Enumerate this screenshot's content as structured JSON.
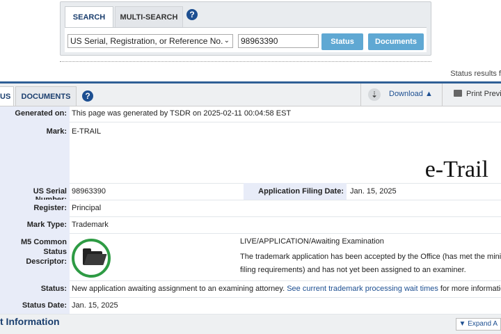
{
  "search": {
    "tabs": [
      "SEARCH",
      "MULTI-SEARCH"
    ],
    "type_selected": "US Serial, Registration, or Reference No.",
    "serial_value": "98963390",
    "status_button": "Status",
    "documents_button": "Documents"
  },
  "status_results_text": "Status results f",
  "tabs": {
    "status": "US",
    "documents": "DOCUMENTS",
    "download": "Download",
    "print": "Print Previe"
  },
  "info": {
    "generated_label": "Generated on:",
    "generated_value": "This page was generated by TSDR on 2025-02-11 00:04:58 EST",
    "mark_label": "Mark:",
    "mark_value": "E-TRAIL",
    "mark_image_text": "e-Trail",
    "serial_label": "US Serial Number:",
    "serial_value": "98963390",
    "filing_label": "Application Filing Date:",
    "filing_value": "Jan. 15, 2025",
    "register_label": "Register:",
    "register_value": "Principal",
    "marktype_label": "Mark Type:",
    "marktype_value": "Trademark",
    "descriptor_label_1": "M5 Common Status",
    "descriptor_label_2": "Descriptor:",
    "descriptor_title": "LIVE/APPLICATION/Awaiting Examination",
    "descriptor_text_1": "The trademark application has been accepted by the Office (has met the minimu",
    "descriptor_text_2": "filing requirements) and has not yet been assigned to an examiner.",
    "status_label": "Status:",
    "status_text_1": "New application awaiting assignment to an examining attorney.",
    "status_link": "See current trademark processing wait times",
    "status_text_2": "for more information.",
    "statusdate_label": "Status Date:",
    "statusdate_value": "Jan. 15, 2025"
  },
  "section": {
    "title": "t Information",
    "expand": "Expand A"
  },
  "icons": {
    "help": "help-icon",
    "download": "download-icon",
    "print": "print-icon",
    "folder": "folder-icon"
  },
  "colors": {
    "accent": "#1d4f91",
    "button": "#5fa8d3",
    "ring": "#2e9b44",
    "label_bg": "#e8ecf8"
  }
}
